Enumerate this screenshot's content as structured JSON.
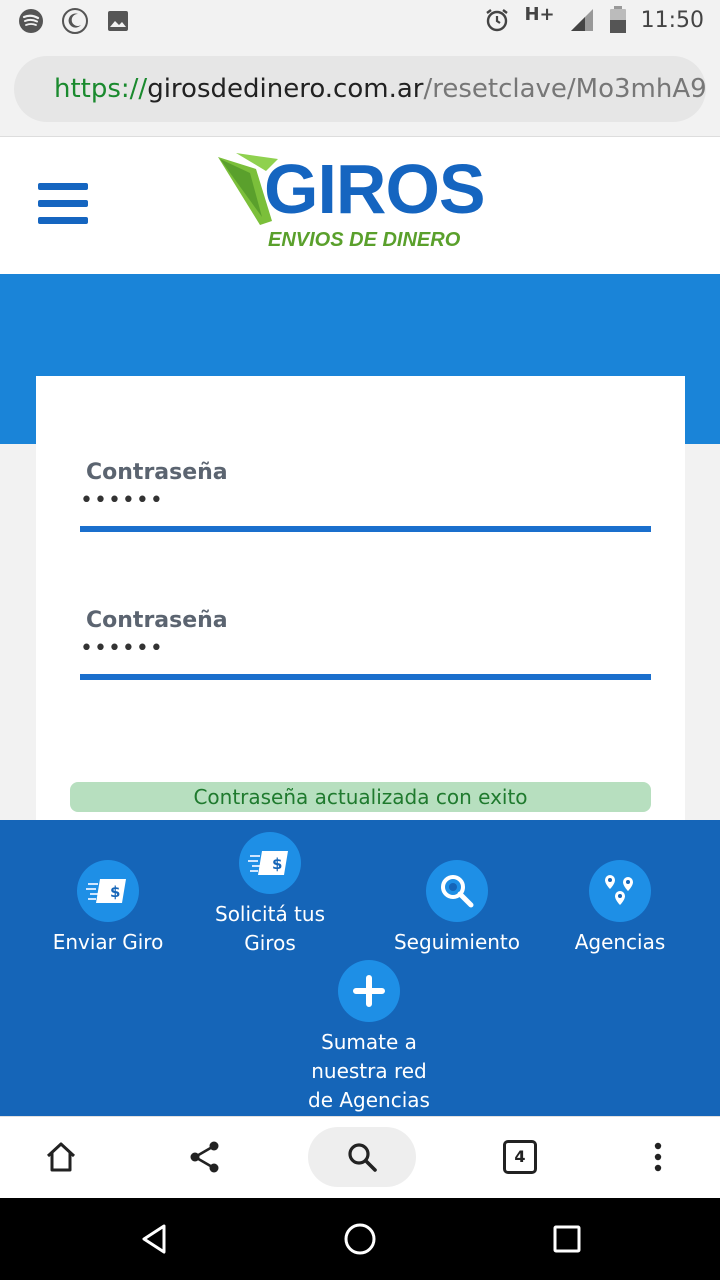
{
  "status_bar": {
    "time": "11:50",
    "network": "H+",
    "left_icons": [
      "spotify-icon",
      "moon-icon",
      "image-icon"
    ],
    "right_icons": [
      "alarm-icon",
      "signal-icon",
      "battery-icon"
    ]
  },
  "browser": {
    "url_scheme": "https://",
    "url_host": "girosdedinero.com.ar",
    "url_path": "/resetclave/Mo3mhA9",
    "tab_count": "4"
  },
  "header": {
    "brand": "GIROS",
    "tagline": "ENVIOS DE DINERO"
  },
  "form": {
    "field1_label": "Contraseña",
    "field1_value": "••••••",
    "field2_label": "Contraseña",
    "field2_value": "••••••",
    "success_message": "Contraseña actualizada con exito"
  },
  "footer_nav": {
    "enviar_giro": "Enviar Giro",
    "solicita_line1": "Solicitá tus",
    "solicita_line2": "Giros",
    "seguimiento": "Seguimiento",
    "agencias": "Agencias",
    "sumate_line1": "Sumate a",
    "sumate_line2": "nuestra red",
    "sumate_line3": "de Agencias"
  },
  "colors": {
    "brand_blue": "#1565c0",
    "band_blue": "#1a84d8",
    "footer_blue": "#1565b8",
    "brand_green": "#5aa02c",
    "success_bg": "#b7dfbf",
    "success_text": "#1f7a2e"
  }
}
